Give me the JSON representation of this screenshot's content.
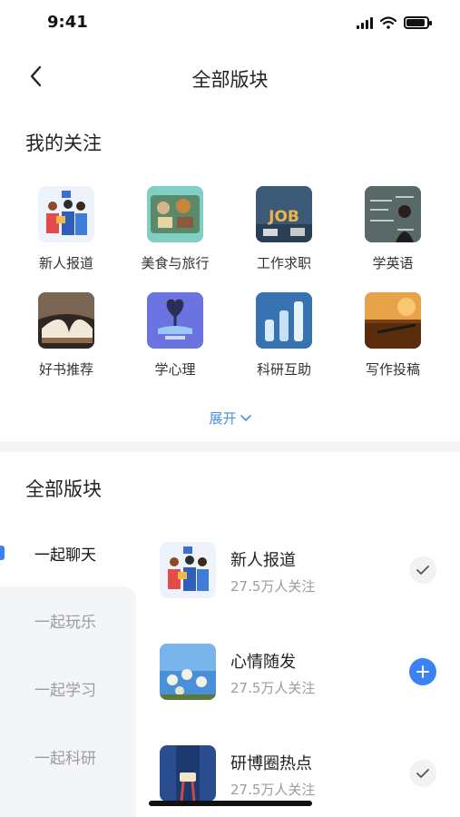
{
  "status_bar": {
    "time": "9:41"
  },
  "nav": {
    "title": "全部版块",
    "back_icon": "chevron-left-icon"
  },
  "my_follow": {
    "title": "我的关注",
    "items": [
      {
        "label": "新人报道",
        "icon": "newcomer-thumb"
      },
      {
        "label": "美食与旅行",
        "icon": "food-travel-thumb"
      },
      {
        "label": "工作求职",
        "icon": "job-thumb"
      },
      {
        "label": "学英语",
        "icon": "english-thumb"
      },
      {
        "label": "好书推荐",
        "icon": "book-thumb"
      },
      {
        "label": "学心理",
        "icon": "psychology-thumb"
      },
      {
        "label": "科研互助",
        "icon": "research-thumb"
      },
      {
        "label": "写作投稿",
        "icon": "writing-thumb"
      }
    ],
    "expand_label": "展开"
  },
  "all_boards": {
    "title": "全部版块",
    "categories": [
      {
        "label": "一起聊天",
        "active": true
      },
      {
        "label": "一起玩乐",
        "active": false
      },
      {
        "label": "一起学习",
        "active": false
      },
      {
        "label": "一起科研",
        "active": false
      }
    ],
    "boards": [
      {
        "title": "新人报道",
        "followers": "27.5万人关注",
        "state": "followed"
      },
      {
        "title": "心情随发",
        "followers": "27.5万人关注",
        "state": "add"
      },
      {
        "title": "研博圈热点",
        "followers": "27.5万人关注",
        "state": "followed"
      }
    ]
  },
  "colors": {
    "accent": "#3b82f6",
    "link": "#4a90e2",
    "muted": "#9a9ca1",
    "panel": "#f4f5f7"
  }
}
